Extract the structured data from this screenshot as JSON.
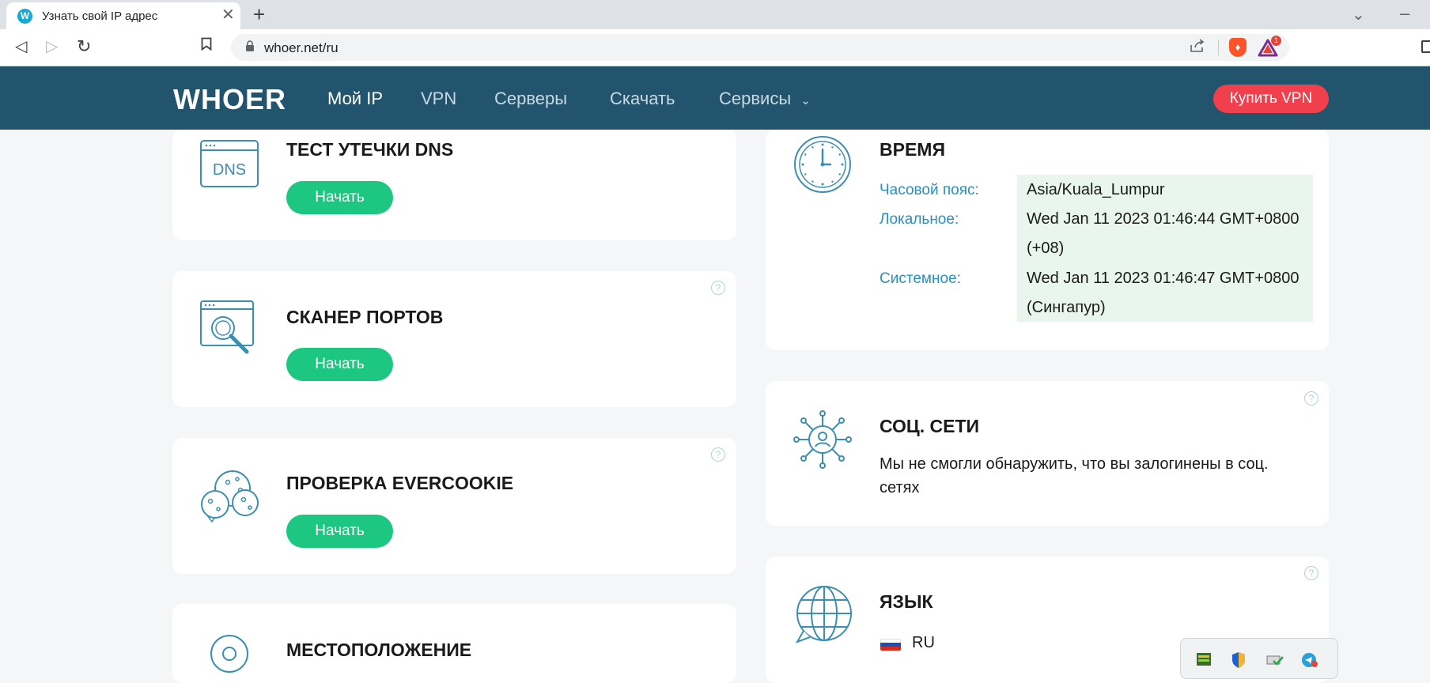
{
  "browser": {
    "tab_title": "Узнать свой IP адрес",
    "favicon_letter": "W",
    "url": "whoer.net/ru",
    "rewards_badge": "1"
  },
  "header": {
    "logo": "WHOER",
    "nav": {
      "my_ip": "Мой IP",
      "vpn": "VPN",
      "servers": "Серверы",
      "download": "Скачать",
      "services": "Сервисы"
    },
    "buy_vpn": "Купить VPN"
  },
  "cards": {
    "dns": {
      "title": "ТЕСТ УТЕЧКИ DNS",
      "icon_text": "DNS",
      "button": "Начать"
    },
    "ports": {
      "title": "СКАНЕР ПОРТОВ",
      "button": "Начать"
    },
    "evercookie": {
      "title": "ПРОВЕРКА EVERCOOKIE",
      "button": "Начать"
    },
    "location": {
      "title": "МЕСТОПОЛОЖЕНИЕ"
    },
    "time": {
      "title": "ВРЕМЯ",
      "timezone_label": "Часовой пояс:",
      "timezone_value": "Asia/Kuala_Lumpur",
      "local_label": "Локальное:",
      "local_value_line1": "Wed Jan 11 2023 01:46:44 GMT+0800",
      "local_value_line2": "(+08)",
      "system_label": "Системное:",
      "system_value_line1": "Wed Jan 11 2023 01:46:47 GMT+0800",
      "system_value_line2": "(Сингапур)"
    },
    "social": {
      "title": "СОЦ. СЕТИ",
      "text": "Мы не смогли обнаружить, что вы залогинены в соц. сетях"
    },
    "language": {
      "title": "ЯЗЫК",
      "code": "RU"
    }
  },
  "help_symbol": "?",
  "colors": {
    "header_bg": "#22546e",
    "accent_red": "#f0404d",
    "accent_green": "#1dc781",
    "icon_teal": "#3d8fb0",
    "label_blue": "#2a8fbd",
    "highlight_bg": "#e9f6ee"
  }
}
